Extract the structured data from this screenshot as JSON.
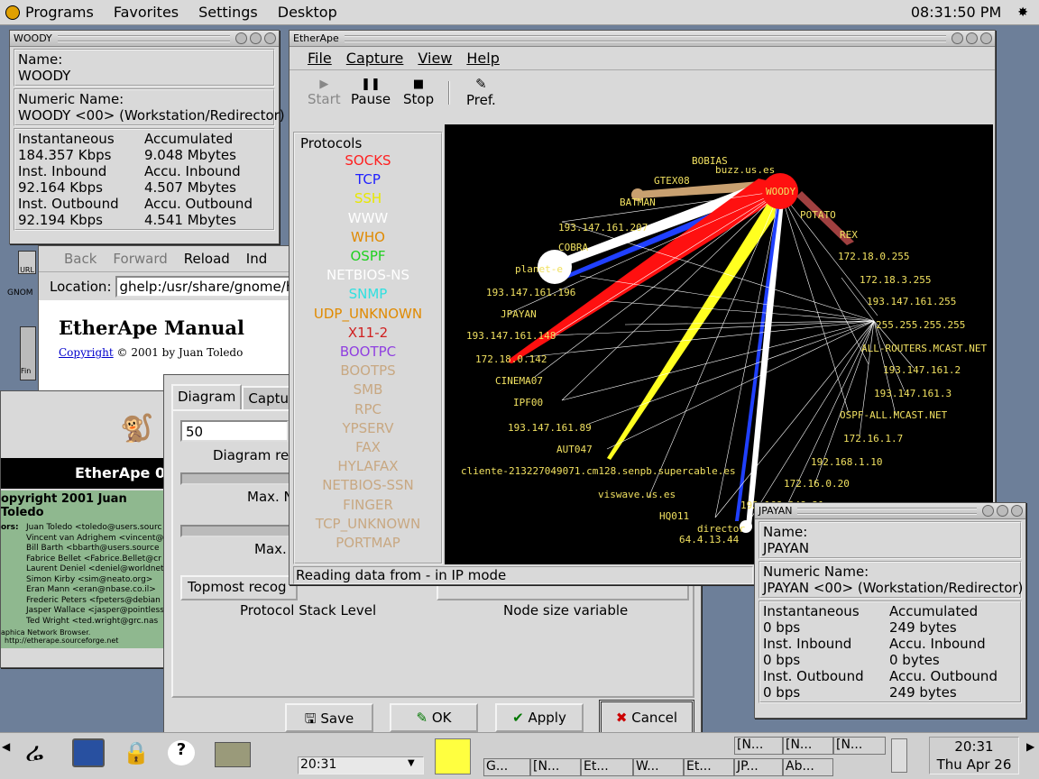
{
  "topbar": {
    "menus": [
      "Programs",
      "Favorites",
      "Settings",
      "Desktop"
    ],
    "clock": "08:31:50 PM"
  },
  "woody": {
    "title": "WOODY",
    "name_label": "Name:",
    "name": "WOODY",
    "numeric_label": "Numeric Name:",
    "numeric": "WOODY <00> (Workstation/Redirector)",
    "stats": [
      [
        "Instantaneous",
        "Accumulated"
      ],
      [
        "184.357 Kbps",
        "9.048 Mbytes"
      ],
      [
        "Inst. Inbound",
        "Accu. Inbound"
      ],
      [
        "92.164 Kbps",
        "4.507 Mbytes"
      ],
      [
        "Inst. Outbound",
        "Accu. Outbound"
      ],
      [
        "92.194 Kbps",
        "4.541 Mbytes"
      ]
    ]
  },
  "browser": {
    "back": "Back",
    "forward": "Forward",
    "reload": "Reload",
    "index": "Ind",
    "location_label": "Location:",
    "location": "ghelp:/usr/share/gnome/h",
    "heading": "EtherApe Manual",
    "copyright_link": "Copyright",
    "copyright_text": "© 2001 by Juan Toledo"
  },
  "about": {
    "title": "EtherApe 0",
    "copyright": "opyright 2001 Juan Toledo",
    "authors_label": "ors:",
    "authors": [
      "Juan Toledo <toledo@users.sourc",
      "Vincent van Adrighem <vincent@",
      "Bill Barth <bbarth@users.source",
      "Fabrice Bellet <Fabrice.Bellet@cr",
      "Laurent Deniel <deniel@worldnet",
      "Simon Kirby <sim@neato.org>",
      "Eran Mann <eran@nbase.co.il>",
      "Frederic Peters <fpeters@debian",
      "Jasper Wallace <jasper@pointless",
      "Ted Wright <ted.wright@grc.nas"
    ],
    "footer1": "aphica Network Browser.",
    "footer2": "http://etherape.sourceforge.net"
  },
  "prefs": {
    "tab_diagram": "Diagram",
    "tab_capture": "Captur",
    "value": "50",
    "diag_refresh": "Diagram re",
    "max_n": "Max. N",
    "max2": "Max.",
    "topmost": "Topmost recog",
    "proto_level": "Protocol Stack Level",
    "node_size": "Node size variable",
    "save": "Save",
    "ok": "OK",
    "apply": "Apply",
    "cancel": "Cancel"
  },
  "etherape": {
    "title": "EtherApe",
    "menus": [
      "File",
      "Capture",
      "View",
      "Help"
    ],
    "tools": {
      "start": "Start",
      "pause": "Pause",
      "stop": "Stop",
      "pref": "Pref."
    },
    "protocols_title": "Protocols",
    "status": "Reading data from - in IP mode",
    "protocols": [
      {
        "name": "SOCKS",
        "color": "#ff2020"
      },
      {
        "name": "TCP",
        "color": "#2020ff"
      },
      {
        "name": "SSH",
        "color": "#e8e800"
      },
      {
        "name": "WWW",
        "color": "#ffffff"
      },
      {
        "name": "WHO",
        "color": "#e08a00"
      },
      {
        "name": "OSPF",
        "color": "#20d020"
      },
      {
        "name": "NETBIOS-NS",
        "color": "#ffffff"
      },
      {
        "name": "SNMP",
        "color": "#30e0e0"
      },
      {
        "name": "UDP_UNKNOWN",
        "color": "#e08a00"
      },
      {
        "name": "X11-2",
        "color": "#d02020"
      },
      {
        "name": "BOOTPC",
        "color": "#9040e0"
      },
      {
        "name": "BOOTPS",
        "color": "#c8a882"
      },
      {
        "name": "SMB",
        "color": "#c8a882"
      },
      {
        "name": "RPC",
        "color": "#c8a882"
      },
      {
        "name": "YPSERV",
        "color": "#c8a882"
      },
      {
        "name": "FAX",
        "color": "#c8a882"
      },
      {
        "name": "HYLAFAX",
        "color": "#c8a882"
      },
      {
        "name": "NETBIOS-SSN",
        "color": "#c8a882"
      },
      {
        "name": "FINGER",
        "color": "#c8a882"
      },
      {
        "name": "TCP_UNKNOWN",
        "color": "#c8a882"
      },
      {
        "name": "PORTMAP",
        "color": "#c8a882"
      }
    ],
    "nodes": [
      "BOBIAS",
      "buzz.us.es",
      "GTEX08",
      "BATMAN",
      "WOODY",
      "POTATO",
      "REX",
      "193.147.161.207",
      "COBRA",
      "planet-e",
      "172.18.0.255",
      "172.18.3.255",
      "193.147.161.196",
      "193.147.161.255",
      "JPAYAN",
      "255.255.255.255",
      "193.147.161.148",
      "ALL-ROUTERS.MCAST.NET",
      "172.18.0.142",
      "193.147.161.2",
      "CINEMA07",
      "193.147.161.3",
      "IPF00",
      "OSPF-ALL.MCAST.NET",
      "193.147.161.89",
      "172.16.1.7",
      "AUT047",
      "192.168.1.10",
      "cliente-213227049071.cm128.senpb.supercable.es",
      "172.16.0.20",
      "viswave.us.es",
      "192.168.248.21",
      "HQ011",
      "director",
      "64.4.13.44"
    ]
  },
  "jpayan": {
    "title": "JPAYAN",
    "name_label": "Name:",
    "name": "JPAYAN",
    "numeric_label": "Numeric Name:",
    "numeric": "JPAYAN <00> (Workstation/Redirector)",
    "stats": [
      [
        "Instantaneous",
        "Accumulated"
      ],
      [
        "0 bps",
        "249 bytes"
      ],
      [
        "Inst. Inbound",
        "Accu. Inbound"
      ],
      [
        "0 bps",
        "0 bytes"
      ],
      [
        "Inst. Outbound",
        "Accu. Outbound"
      ],
      [
        "0 bps",
        "249 bytes"
      ]
    ]
  },
  "taskbar": {
    "clock_time": "20:31",
    "clock_date": "Thu Apr 26",
    "pager_time": "20:31",
    "tasks": [
      "G...",
      "[N...",
      "Et...",
      "W...",
      "Et...",
      "JP...",
      "Ab...",
      "[N...",
      "[N...",
      "[N..."
    ]
  },
  "desktop_icons": [
    "URL",
    "GNOM",
    "Fin"
  ]
}
